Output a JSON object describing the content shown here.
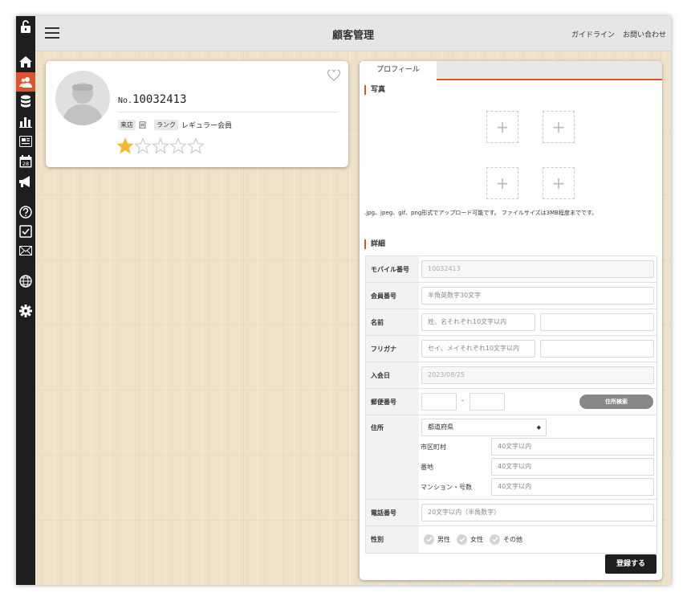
{
  "header": {
    "title": "顧客管理",
    "links": [
      "ガイドライン",
      "お問い合わせ"
    ]
  },
  "sidebar": {
    "icons": [
      "lock-icon",
      "home-icon",
      "users-icon",
      "database-icon",
      "stats-icon",
      "reader-icon",
      "calendar-icon",
      "megaphone-icon",
      "help-icon",
      "checkbox-icon",
      "mail-icon",
      "globe-icon",
      "gear-icon"
    ],
    "calendar_day": "28",
    "active": "users-icon"
  },
  "profile": {
    "no_prefix": "No.",
    "customer_no": "10032413",
    "visit_tag": "来店",
    "visit_count": "回",
    "rank_tag": "ランク",
    "rank_value": "レギュラー会員",
    "rating": 1,
    "rating_max": 5
  },
  "tabs": [
    "プロフィール"
  ],
  "photo": {
    "section_title": "写真",
    "note": ".jpg、jpeg、gif、png形式でアップロード可能です。 ファイルサイズは3MB程度までです。"
  },
  "detail": {
    "section_title": "詳細",
    "mobile_label": "モバイル番号",
    "mobile_value": "10032413",
    "member_label": "会員番号",
    "member_placeholder": "半角英数字30文字",
    "name_label": "名前",
    "name_placeholder": "姓、名それぞれ10文字以内",
    "kana_label": "フリガナ",
    "kana_placeholder": "セイ、メイそれぞれ10文字以内",
    "joined_label": "入会日",
    "joined_value": "2023/08/25",
    "zip_label": "郵便番号",
    "zip_sep": "-",
    "zip_search": "住所検索",
    "address_label": "住所",
    "prefecture_select": "都道府県",
    "city_label": "市区町村",
    "city_placeholder": "40文字以内",
    "street_label": "番地",
    "street_placeholder": "40文字以内",
    "building_label": "マンション・号数",
    "building_placeholder": "40文字以内",
    "phone_label": "電話番号",
    "phone_placeholder": "20文字以内（半角数字）",
    "gender_label": "性別",
    "gender_options": [
      "男性",
      "女性",
      "その他"
    ]
  },
  "submit_label": "登録する",
  "colors": {
    "accent": "#d9552c",
    "sidebar": "#1e1e1e",
    "star": "#f5b731"
  }
}
